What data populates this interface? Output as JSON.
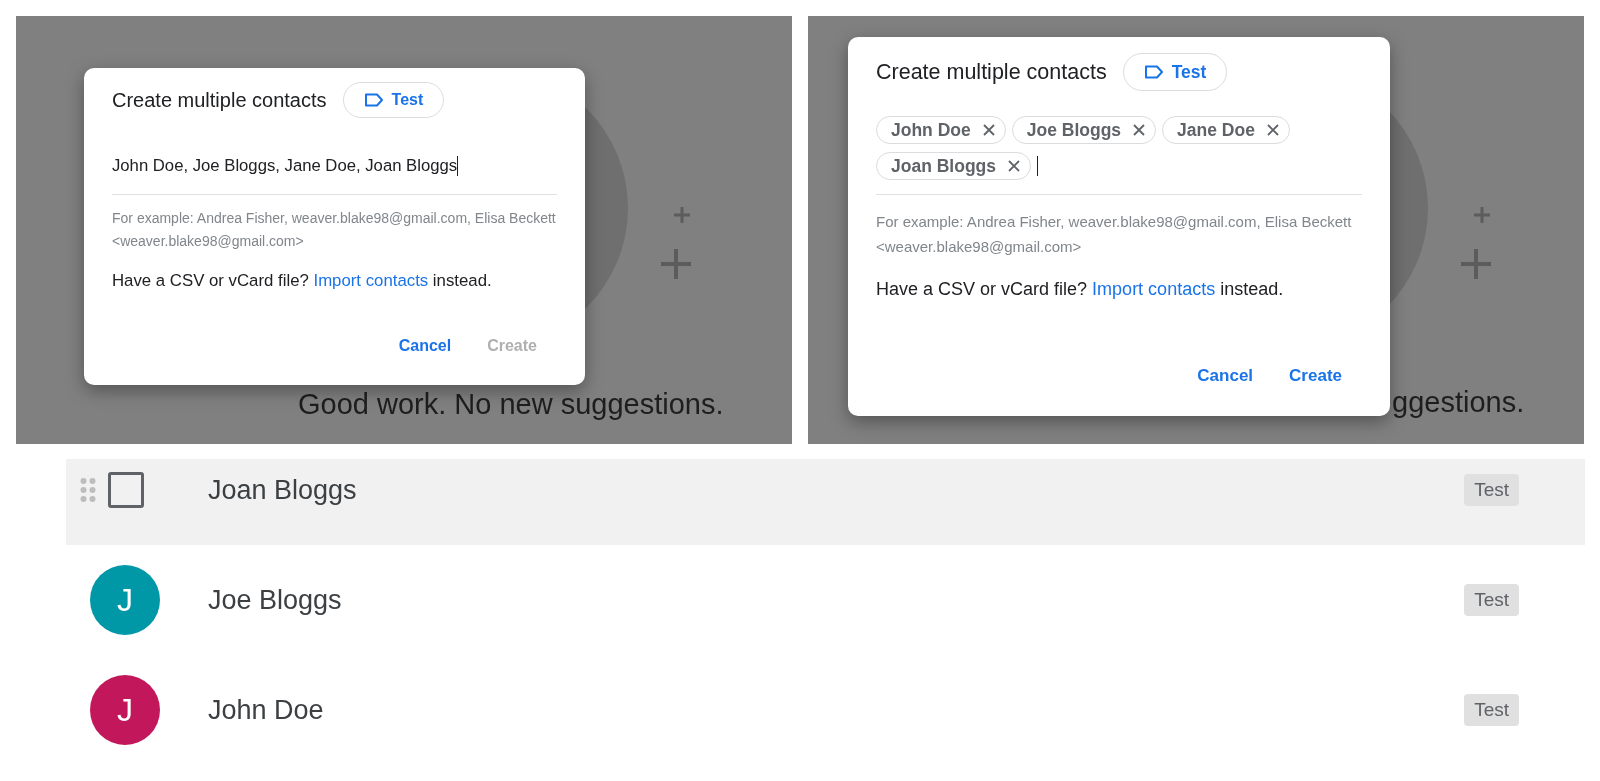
{
  "panels": [
    {
      "kind": "text_input",
      "background_text": "Good work. No new suggestions.",
      "dialog": {
        "title": "Create multiple contacts",
        "label_chip": "Test",
        "input_value": "John Doe, Joe Bloggs, Jane Doe, Joan Bloggs",
        "hint": "For example: Andrea Fisher, weaver.blake98@gmail.com, Elisa Beckett <weaver.blake98@gmail.com>",
        "import_prompt": {
          "before": "Have a CSV or vCard file?",
          "link": "Import contacts",
          "after": "instead."
        },
        "buttons": [
          {
            "label": "Cancel",
            "disabled": false
          },
          {
            "label": "Create",
            "disabled": true
          }
        ]
      }
    },
    {
      "kind": "chips",
      "background_text": "ggestions.",
      "dialog": {
        "title": "Create multiple contacts",
        "label_chip": "Test",
        "chips": [
          "John Doe",
          "Joe Bloggs",
          "Jane Doe",
          "Joan Bloggs"
        ],
        "hint": "For example: Andrea Fisher, weaver.blake98@gmail.com, Elisa Beckett <weaver.blake98@gmail.com>",
        "import_prompt": {
          "before": "Have a CSV or vCard file?",
          "link": "Import contacts",
          "after": "instead."
        },
        "buttons": [
          {
            "label": "Cancel",
            "disabled": false
          },
          {
            "label": "Create",
            "disabled": false
          }
        ]
      }
    }
  ],
  "contacts": [
    {
      "kind": "checkbox",
      "name": "Joan Bloggs",
      "checked": false,
      "highlighted": true,
      "label": "Test"
    },
    {
      "kind": "avatar",
      "name": "Joe Bloggs",
      "initial": "J",
      "color": "#0097a7",
      "highlighted": false,
      "label": "Test"
    },
    {
      "kind": "avatar",
      "name": "John Doe",
      "initial": "J",
      "color": "#c2185b",
      "highlighted": false,
      "label": "Test"
    }
  ]
}
